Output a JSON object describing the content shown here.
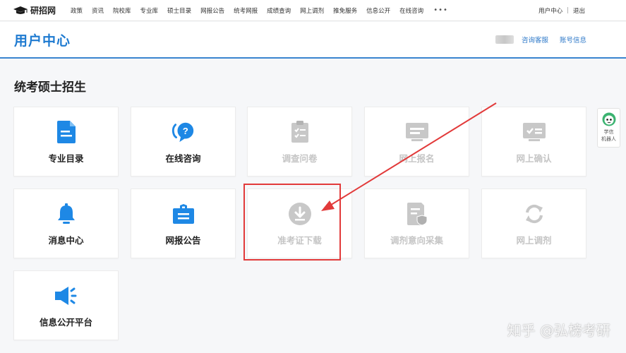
{
  "topnav": {
    "logo_text": "研招网",
    "links": [
      "政策",
      "资讯",
      "院校库",
      "专业库",
      "硕士目录",
      "网报公告",
      "统考网报",
      "成绩查询",
      "网上调剂",
      "推免服务",
      "信息公开",
      "在线咨询"
    ],
    "more": "•••",
    "user_center": "用户中心",
    "separator": "|",
    "logout": "退出"
  },
  "header": {
    "title": "用户中心",
    "links": [
      "咨询客服",
      "账号信息"
    ]
  },
  "section": {
    "title": "统考硕士招生",
    "cards": [
      {
        "label": "专业目录",
        "icon": "document-icon",
        "enabled": true
      },
      {
        "label": "在线咨询",
        "icon": "chat-question-icon",
        "enabled": true
      },
      {
        "label": "调查问卷",
        "icon": "clipboard-check-icon",
        "enabled": false
      },
      {
        "label": "网上报名",
        "icon": "form-card-icon",
        "enabled": false
      },
      {
        "label": "网上确认",
        "icon": "id-check-icon",
        "enabled": false
      },
      {
        "label": "消息中心",
        "icon": "bell-icon",
        "enabled": true
      },
      {
        "label": "网报公告",
        "icon": "briefcase-icon",
        "enabled": true
      },
      {
        "label": "准考证下载",
        "icon": "download-icon",
        "enabled": false
      },
      {
        "label": "调剂意向采集",
        "icon": "document-shield-icon",
        "enabled": false
      },
      {
        "label": "网上调剂",
        "icon": "refresh-icon",
        "enabled": false
      },
      {
        "label": "信息公开平台",
        "icon": "megaphone-icon",
        "enabled": true
      }
    ]
  },
  "robot": {
    "line1": "学信",
    "line2": "机器人"
  },
  "watermark": "知乎 @弘榜考研",
  "colors": {
    "accent": "#1e7ad0",
    "icon_blue": "#1e88e5",
    "disabled": "#c5c5c5",
    "highlight": "#e23a3a"
  }
}
